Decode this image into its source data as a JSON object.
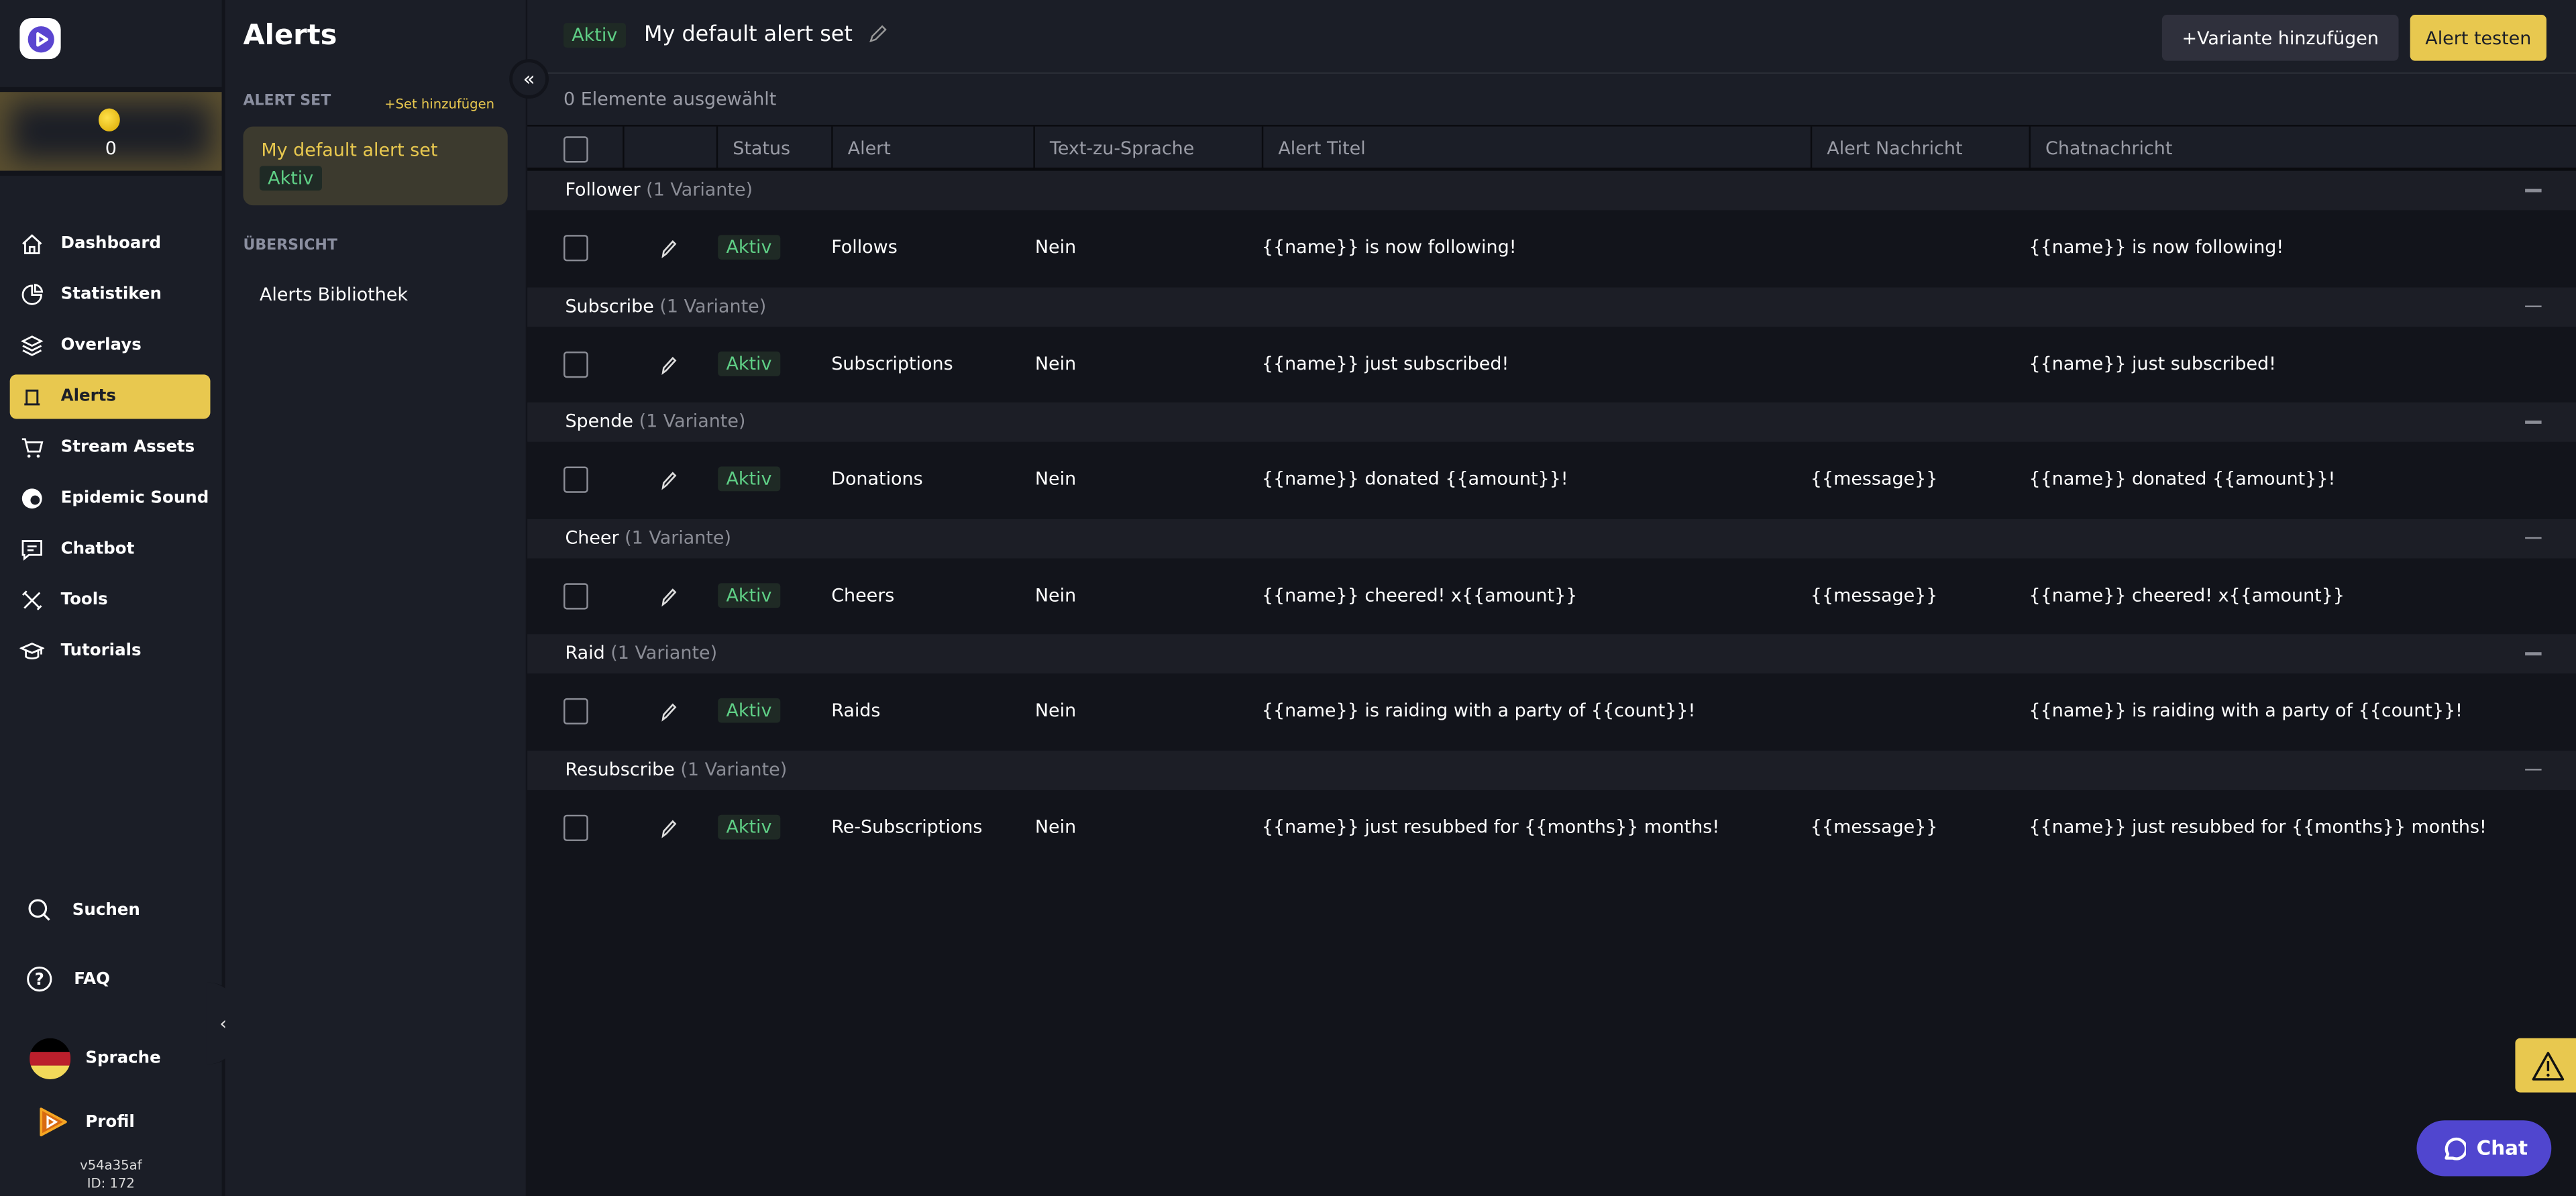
{
  "nav": {
    "coins": "0",
    "items": [
      {
        "label": "Dashboard",
        "icon": "home-icon"
      },
      {
        "label": "Statistiken",
        "icon": "pie-chart-icon"
      },
      {
        "label": "Overlays",
        "icon": "layers-icon"
      },
      {
        "label": "Alerts",
        "icon": "alert-icon",
        "active": true
      },
      {
        "label": "Stream Assets",
        "icon": "cart-icon"
      },
      {
        "label": "Epidemic Sound",
        "icon": "epidemic-icon"
      },
      {
        "label": "Chatbot",
        "icon": "chat-icon"
      },
      {
        "label": "Tools",
        "icon": "tools-icon"
      },
      {
        "label": "Tutorials",
        "icon": "graduation-icon"
      }
    ],
    "search": "Suchen",
    "faq": "FAQ",
    "language": "Sprache",
    "profile": "Profil",
    "version": "v54a35af",
    "id": "ID: 172"
  },
  "panel": {
    "title": "Alerts",
    "alert_set_label": "ALERT SET",
    "add_set": "Set hinzufügen",
    "set_name": "My default alert set",
    "set_status": "Aktiv",
    "overview_label": "ÜBERSICHT",
    "library": "Alerts Bibliothek"
  },
  "header": {
    "status": "Aktiv",
    "title": "My default alert set",
    "add_variant": "Variante hinzufügen",
    "test_alert": "Alert testen"
  },
  "selection": "0 Elemente ausgewählt",
  "columns": [
    "Status",
    "Alert",
    "Text-zu-Sprache",
    "Alert Titel",
    "Alert Nachricht",
    "Chatnachricht"
  ],
  "groups": [
    {
      "name": "Follower",
      "count": "(1 Variante)",
      "row": {
        "status": "Aktiv",
        "alert": "Follows",
        "tts": "Nein",
        "title": "{{name}} is now following!",
        "message": "",
        "chat": "{{name}} is now following!"
      }
    },
    {
      "name": "Subscribe",
      "count": "(1 Variante)",
      "row": {
        "status": "Aktiv",
        "alert": "Subscriptions",
        "tts": "Nein",
        "title": "{{name}} just subscribed!",
        "message": "",
        "chat": "{{name}} just subscribed!"
      }
    },
    {
      "name": "Spende",
      "count": "(1 Variante)",
      "row": {
        "status": "Aktiv",
        "alert": "Donations",
        "tts": "Nein",
        "title": "{{name}} donated {{amount}}!",
        "message": "{{message}}",
        "chat": "{{name}} donated {{amount}}!"
      }
    },
    {
      "name": "Cheer",
      "count": "(1 Variante)",
      "row": {
        "status": "Aktiv",
        "alert": "Cheers",
        "tts": "Nein",
        "title": "{{name}} cheered! x{{amount}}",
        "message": "{{message}}",
        "chat": "{{name}} cheered! x{{amount}}"
      }
    },
    {
      "name": "Raid",
      "count": "(1 Variante)",
      "row": {
        "status": "Aktiv",
        "alert": "Raids",
        "tts": "Nein",
        "title": "{{name}} is raiding with a party of {{count}}!",
        "message": "",
        "chat": "{{name}} is raiding with a party of {{count}}!"
      }
    },
    {
      "name": "Resubscribe",
      "count": "(1 Variante)",
      "row": {
        "status": "Aktiv",
        "alert": "Re-Subscriptions",
        "tts": "Nein",
        "title": "{{name}} just resubbed for {{months}} months!",
        "message": "{{message}}",
        "chat": "{{name}} just resubbed for {{months}} months!"
      }
    }
  ],
  "chat_button": "Chat",
  "colors": {
    "accent": "#e8c84f",
    "active": "#5fcf86",
    "chat": "#5046cf"
  }
}
